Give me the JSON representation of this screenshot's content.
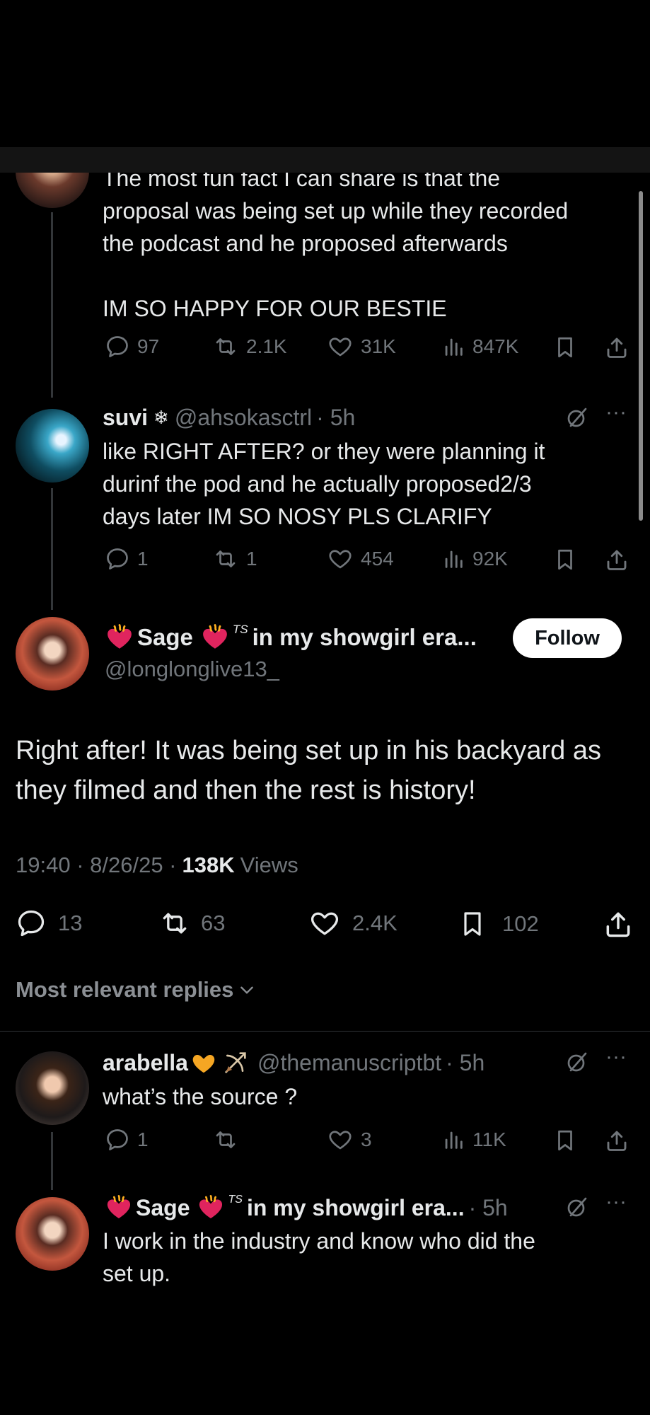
{
  "reply_prev": {
    "body": "The most fun fact I can share is that the\nproposal was being set up while they recorded\nthe podcast and he proposed afterwards\n\nIM SO HAPPY FOR OUR BESTIE",
    "replies": "97",
    "reposts": "2.1K",
    "likes": "31K",
    "views": "847K"
  },
  "reply_suvi": {
    "name": "suvi",
    "handle": "@ahsokasctrl",
    "time": "· 5h",
    "body": "like RIGHT AFTER? or they were planning it\ndurinf the pod and he actually proposed2/3\ndays later IM SO NOSY PLS CLARIFY",
    "replies": "1",
    "reposts": "1",
    "likes": "454",
    "views": "92K"
  },
  "main_post": {
    "name_a": "Sage",
    "name_b": "in my showgirl era...",
    "ts_mark": "TS",
    "handle": "@longlonglive13_",
    "follow_label": "Follow",
    "body": "Right after! It was being set up in his backyard as\nthey filmed and then the rest is history!",
    "time": "19:40 · 8/26/25 ·",
    "views_count": "138K",
    "views_label": "Views",
    "replies": "13",
    "reposts": "63",
    "likes": "2.4K",
    "bookmarks": "102"
  },
  "sort_label": "Most relevant replies",
  "reply_arabella": {
    "name": "arabella",
    "handle": "@themanuscriptbt",
    "time": "· 5h",
    "body": "what’s the source ?",
    "replies": "1",
    "reposts": "",
    "likes": "3",
    "views": "11K"
  },
  "reply_sage": {
    "name_a": "Sage",
    "name_b": "in my showgirl era...",
    "ts_mark": "TS",
    "time": "· 5h",
    "body": "I work in the industry and know who did the\nset up."
  },
  "colors": {
    "background": "#000000",
    "text": "#e7e9ea",
    "muted": "#71767b",
    "follow_bg": "#ffffff"
  }
}
